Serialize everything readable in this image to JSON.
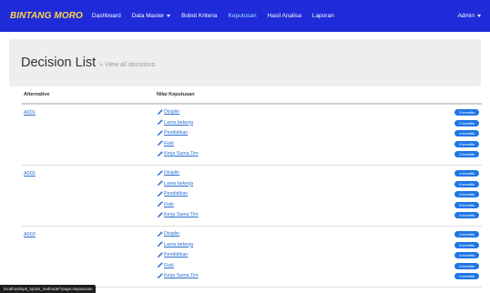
{
  "navbar": {
    "brand": "BINTANG MORO",
    "items": [
      "Dashboard",
      "Data Master",
      "Bobot Kriteria",
      "Keputusan",
      "Hasil Analisa",
      "Laporan"
    ],
    "user": "Admin"
  },
  "page": {
    "title": "Decision List",
    "subtitle": "» View all decisions."
  },
  "table": {
    "headers": [
      "Alternative",
      "Nilai Keputusan"
    ],
    "rows": [
      {
        "alternative": "A001",
        "criteria": [
          "Disiplin",
          "Lama bekerja",
          "Pendidikan",
          "Fisik",
          "Kerja Sama Tim"
        ],
        "badges": [
          "3 benefits",
          "2 benefits",
          "4 benefits",
          "3 benefits",
          "2 benefits"
        ]
      },
      {
        "alternative": "A002",
        "criteria": [
          "Disiplin",
          "Lama bekerja",
          "Pendidikan",
          "Fisik",
          "Kerja Sama Tim"
        ],
        "badges": [
          "4 benefits",
          "5 benefits",
          "4 benefits",
          "3 benefits",
          "4 benefits"
        ]
      },
      {
        "alternative": "A003",
        "criteria": [
          "Disiplin",
          "Lama bekerja",
          "Pendidikan",
          "Fisik",
          "Kerja Sama Tim"
        ],
        "badges": [
          "2 benefits",
          "3 benefits",
          "3 benefits",
          "4 benefits",
          "4 benefits"
        ]
      }
    ]
  },
  "status_bar": {
    "url": "localhost/spk_topsis_methode/?page=keputusan"
  },
  "colors": {
    "navbar": "#1f2bd8",
    "brand": "#ffd64a",
    "link": "#2a6fd1",
    "badge": "#1f76e6"
  },
  "icons": {
    "criteria_edit": "pencil-icon",
    "dropdown": "caret-down-icon"
  }
}
